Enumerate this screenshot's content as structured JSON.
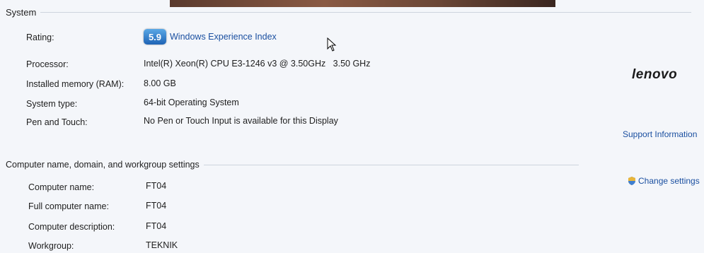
{
  "system": {
    "header": "System",
    "rating": {
      "label": "Rating:",
      "score": "5.9",
      "link": "Windows Experience Index"
    },
    "processor": {
      "label": "Processor:",
      "value": "Intel(R) Xeon(R) CPU E3-1246 v3 @ 3.50GHz   3.50 GHz"
    },
    "memory": {
      "label": "Installed memory (RAM):",
      "value": "8.00 GB"
    },
    "system_type": {
      "label": "System type:",
      "value": "64-bit Operating System"
    },
    "pen_touch": {
      "label": "Pen and Touch:",
      "value": "No Pen or Touch Input is available for this Display"
    }
  },
  "oem": {
    "logo_text": "lenovo",
    "support_link": "Support Information"
  },
  "computer": {
    "header": "Computer name, domain, and workgroup settings",
    "change_settings": "Change settings",
    "name": {
      "label": "Computer name:",
      "value": "FT04"
    },
    "full_name": {
      "label": "Full computer name:",
      "value": "FT04"
    },
    "description": {
      "label": "Computer description:",
      "value": "FT04"
    },
    "workgroup": {
      "label": "Workgroup:",
      "value": "TEKNIK"
    }
  },
  "colors": {
    "link": "#1a4fa0",
    "wei_badge": "#1e63b5",
    "divider": "#cdd4de"
  },
  "icons": {
    "cursor": "arrow-cursor-icon",
    "change_settings": "shield-icon"
  }
}
